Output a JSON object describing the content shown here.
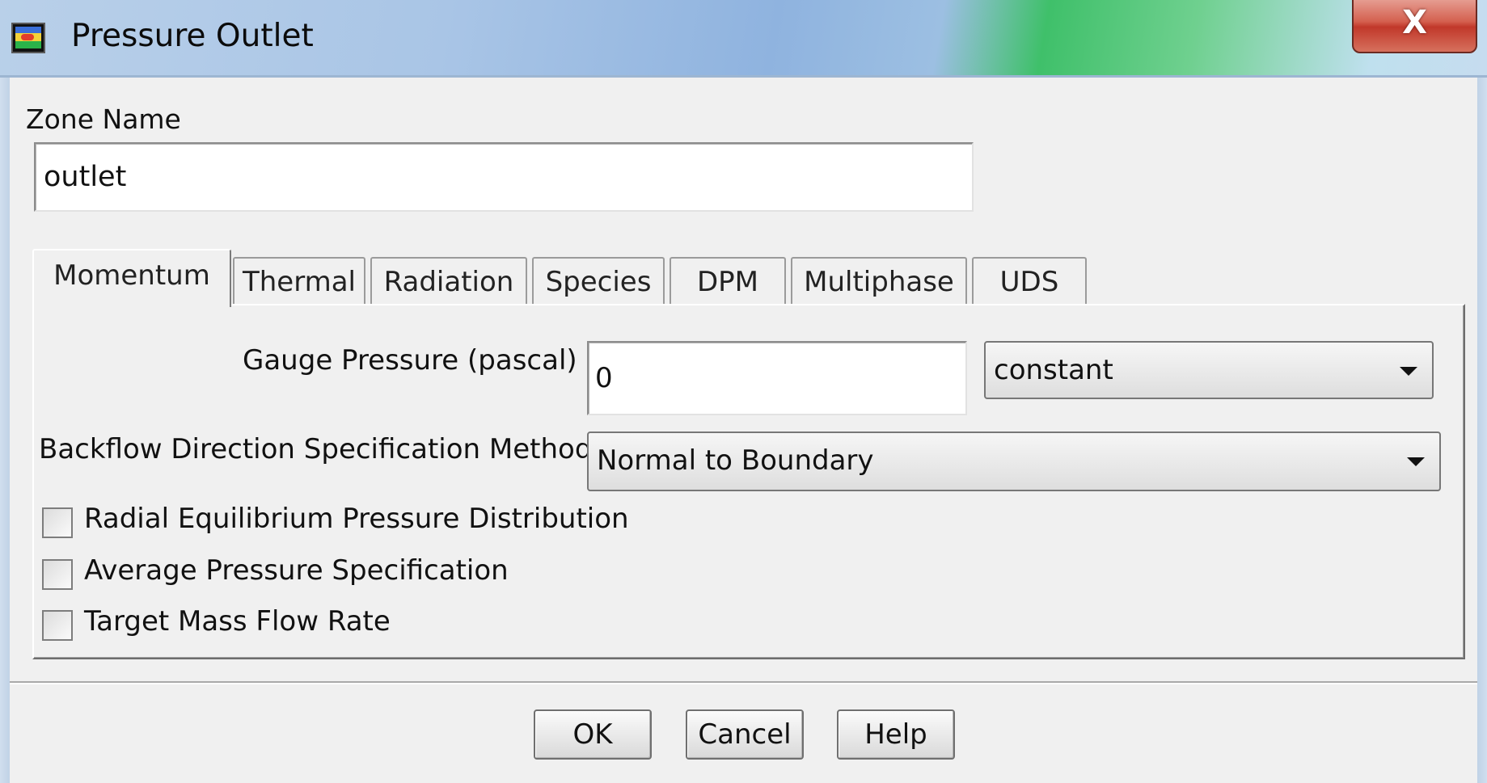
{
  "window": {
    "title": "Pressure Outlet",
    "close_glyph": "X",
    "icon": "fluent-app-icon"
  },
  "zone": {
    "label": "Zone Name",
    "value": "outlet"
  },
  "tabs": [
    {
      "label": "Momentum",
      "active": true
    },
    {
      "label": "Thermal",
      "active": false
    },
    {
      "label": "Radiation",
      "active": false
    },
    {
      "label": "Species",
      "active": false
    },
    {
      "label": "DPM",
      "active": false
    },
    {
      "label": "Multiphase",
      "active": false
    },
    {
      "label": "UDS",
      "active": false
    }
  ],
  "momentum": {
    "gauge_pressure": {
      "label": "Gauge Pressure (pascal)",
      "value": "0",
      "method": "constant"
    },
    "backflow": {
      "label": "Backflow Direction Specification Method",
      "value": "Normal to Boundary"
    },
    "checkboxes": [
      {
        "label": "Radial Equilibrium Pressure Distribution",
        "checked": false
      },
      {
        "label": "Average Pressure Specification",
        "checked": false
      },
      {
        "label": "Target Mass Flow Rate",
        "checked": false
      }
    ]
  },
  "buttons": {
    "ok": "OK",
    "cancel": "Cancel",
    "help": "Help"
  }
}
